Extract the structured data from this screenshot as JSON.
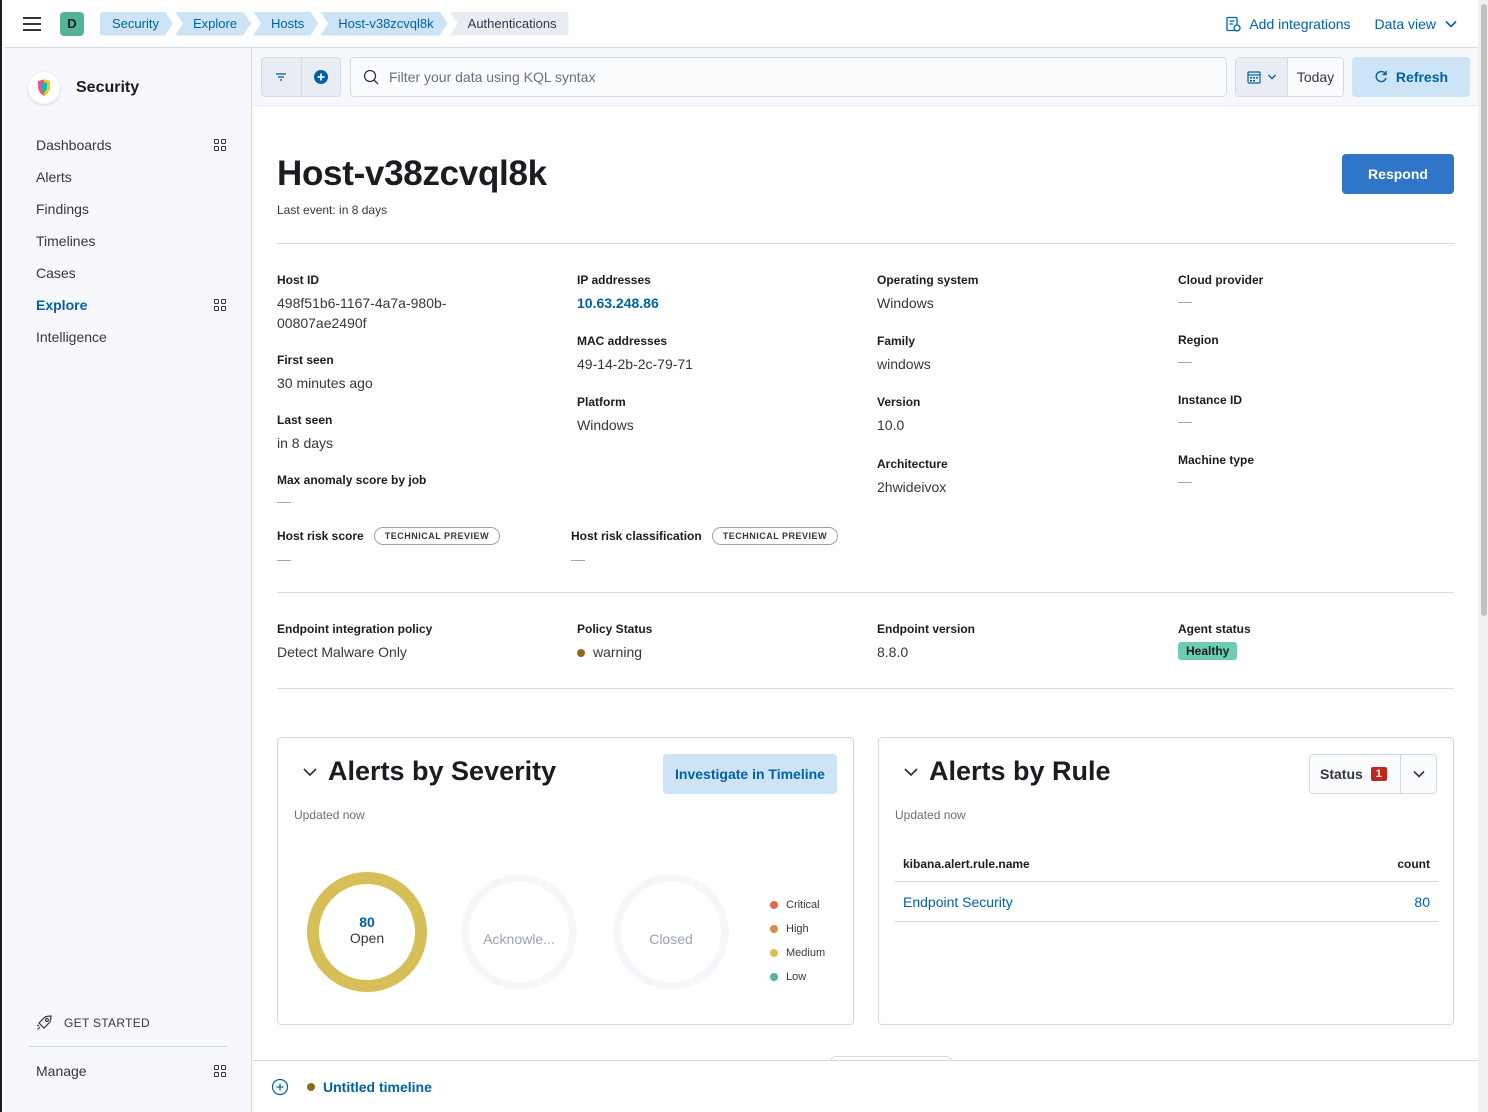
{
  "header": {
    "space_avatar": "D",
    "breadcrumbs": [
      "Security",
      "Explore",
      "Hosts",
      "Host-v38zcvql8k",
      "Authentications"
    ],
    "add_integrations": "Add integrations",
    "data_view": "Data view"
  },
  "sidebar": {
    "brand": "Security",
    "items": [
      {
        "label": "Dashboards",
        "grid": true
      },
      {
        "label": "Alerts",
        "grid": false
      },
      {
        "label": "Findings",
        "grid": false
      },
      {
        "label": "Timelines",
        "grid": false
      },
      {
        "label": "Cases",
        "grid": false
      },
      {
        "label": "Explore",
        "grid": true,
        "active": true
      },
      {
        "label": "Intelligence",
        "grid": false
      }
    ],
    "get_started": "GET STARTED",
    "manage": "Manage"
  },
  "filterbar": {
    "kql_placeholder": "Filter your data using KQL syntax",
    "today": "Today",
    "refresh": "Refresh"
  },
  "host": {
    "title": "Host-v38zcvql8k",
    "last_event": "Last event: in 8 days",
    "respond": "Respond",
    "fields": {
      "host_id_label": "Host ID",
      "host_id_line1": "498f51b6-1167-4a7a-980b-",
      "host_id_line2": "00807ae2490f",
      "first_seen_label": "First seen",
      "first_seen": "30 minutes ago",
      "last_seen_label": "Last seen",
      "last_seen": "in 8 days",
      "max_anomaly_label": "Max anomaly score by job",
      "max_anomaly": "—",
      "ip_label": "IP addresses",
      "ip": "10.63.248.86",
      "mac_label": "MAC addresses",
      "mac": "49-14-2b-2c-79-71",
      "platform_label": "Platform",
      "platform": "Windows",
      "os_label": "Operating system",
      "os": "Windows",
      "family_label": "Family",
      "family": "windows",
      "version_label": "Version",
      "version": "10.0",
      "arch_label": "Architecture",
      "arch": "2hwideivox",
      "cloud_label": "Cloud provider",
      "cloud": "—",
      "region_label": "Region",
      "region": "—",
      "instance_label": "Instance ID",
      "instance": "—",
      "machine_label": "Machine type",
      "machine": "—",
      "risk_score_label": "Host risk score",
      "risk_score": "—",
      "risk_class_label": "Host risk classification",
      "risk_class": "—",
      "tech_preview": "TECHNICAL PREVIEW"
    },
    "endpoint": {
      "policy_label": "Endpoint integration policy",
      "policy": "Detect Malware Only",
      "policy_status_label": "Policy Status",
      "policy_status": "warning",
      "version_label": "Endpoint version",
      "version": "8.8.0",
      "agent_status_label": "Agent status",
      "agent_status": "Healthy"
    }
  },
  "alerts_by_severity": {
    "title": "Alerts by Severity",
    "updated": "Updated now",
    "investigate": "Investigate in Timeline",
    "donuts": [
      {
        "count": "80",
        "label": "Open",
        "fill": 1.0
      },
      {
        "count": "",
        "label": "Acknowle...",
        "fill": 0
      },
      {
        "count": "",
        "label": "Closed",
        "fill": 0
      }
    ],
    "legend": [
      {
        "label": "Critical",
        "color": "#e7664c"
      },
      {
        "label": "High",
        "color": "#da8b45"
      },
      {
        "label": "Medium",
        "color": "#d6bf57"
      },
      {
        "label": "Low",
        "color": "#54b399"
      }
    ],
    "open_color": "#d6bf57"
  },
  "alerts_by_rule": {
    "title": "Alerts by Rule",
    "updated": "Updated now",
    "status_label": "Status",
    "status_count": "1",
    "columns": [
      "kibana.alert.rule.name",
      "count"
    ],
    "rows": [
      {
        "name": "Endpoint Security",
        "count": "80"
      }
    ]
  },
  "timeline": {
    "name": "Untitled timeline"
  }
}
